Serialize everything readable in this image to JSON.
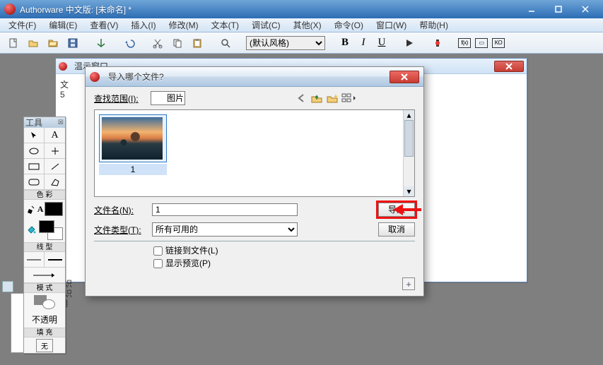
{
  "title": "Authorware 中文版: [未命名] *",
  "menu": [
    "文件(F)",
    "编辑(E)",
    "查看(V)",
    "插入(I)",
    "修改(M)",
    "文本(T)",
    "调试(C)",
    "其他(X)",
    "命令(O)",
    "窗口(W)",
    "帮助(H)"
  ],
  "toolbar": {
    "style_combo": "(默认风格)"
  },
  "design_window": {
    "title": "温示窗口",
    "left_label": "文",
    "left_label2": "5"
  },
  "palette": {
    "title": "工具",
    "sections": {
      "color": "色 彩",
      "line": "线 型",
      "mode": "模 式",
      "fill": "填 充"
    },
    "opacity_label": "不透明",
    "none_label": "无"
  },
  "dialog": {
    "title": "导入哪个文件?",
    "lookin_label": "查找范围(I):",
    "lookin_value": "图片",
    "thumb_name": "1",
    "filename_label": "文件名(N):",
    "filename_value": "1",
    "filetype_label": "文件类型(T):",
    "filetype_value": "所有可用的",
    "import_btn": "导入",
    "cancel_btn": "取消",
    "link_checkbox": "链接到文件(L)",
    "preview_checkbox": "显示预览(P)"
  },
  "side_text": [
    "如识",
    "标识",
    "1用"
  ]
}
